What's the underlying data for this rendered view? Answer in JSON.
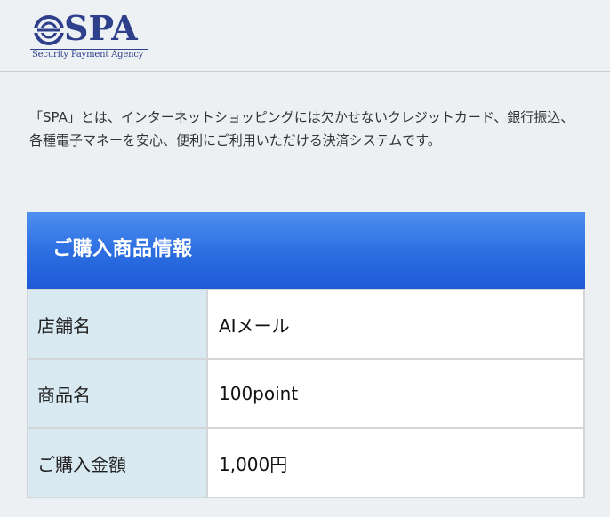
{
  "logo": {
    "text": "SPA",
    "subtitle": "Security Payment Agency",
    "brand_color": "#2e3f8c"
  },
  "intro": {
    "text": "「SPA」とは、インターネットショッピングには欠かせないクレジットカード、銀行振込、各種電子マネーを安心、便利にご利用いただける決済システムです。"
  },
  "purchase_info": {
    "title": "ご購入商品情報",
    "header_color": "#2d6fe2",
    "rows": [
      {
        "label": "店舗名",
        "value": "AIメール"
      },
      {
        "label": "商品名",
        "value": "100point"
      },
      {
        "label": "ご購入金額",
        "value": "1,000円"
      }
    ]
  }
}
